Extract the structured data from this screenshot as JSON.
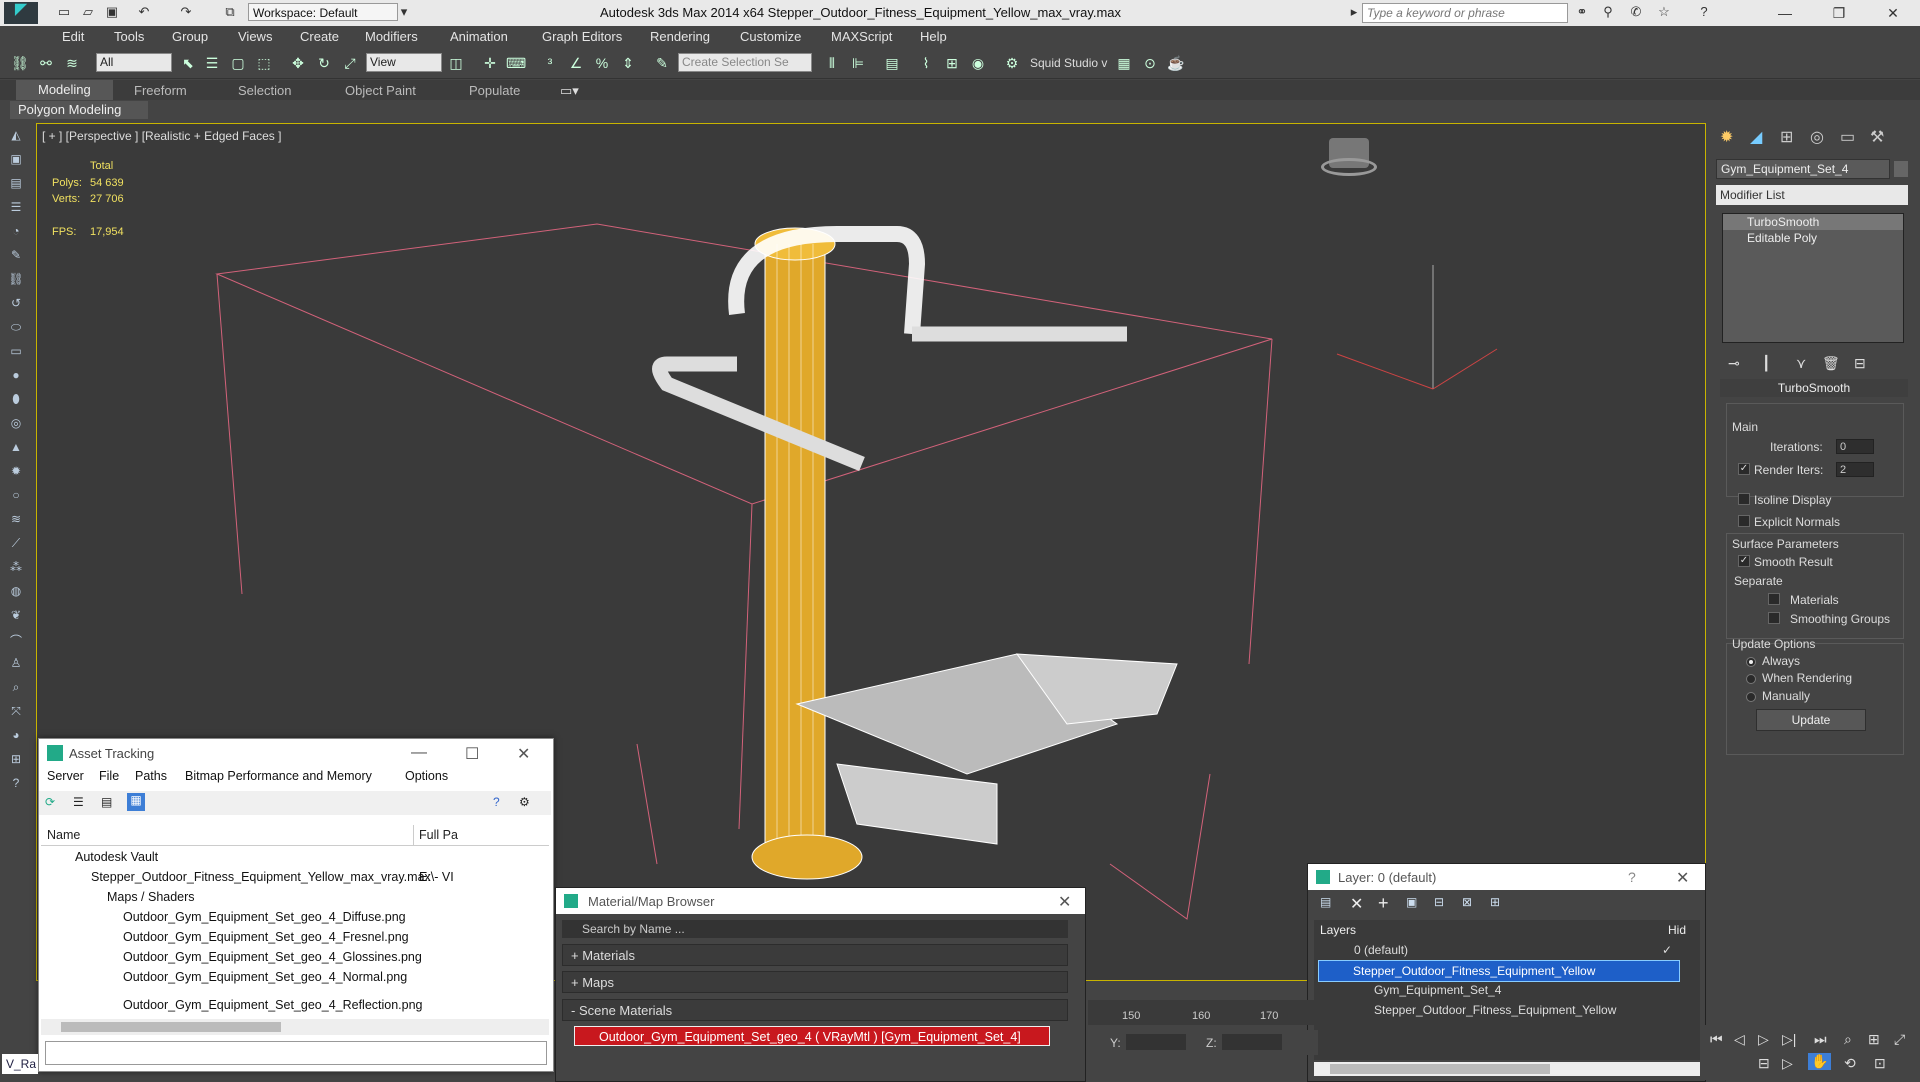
{
  "titlebar": {
    "workspace": "Workspace: Default",
    "title": "Autodesk 3ds Max  2014 x64      Stepper_Outdoor_Fitness_Equipment_Yellow_max_vray.max",
    "search_placeholder": "Type a keyword or phrase"
  },
  "menu": [
    "Edit",
    "Tools",
    "Group",
    "Views",
    "Create",
    "Modifiers",
    "Animation",
    "Graph Editors",
    "Rendering",
    "Customize",
    "MAXScript",
    "Help"
  ],
  "toolbar": {
    "filter": "All",
    "refcoord": "View",
    "selection_set": "Create Selection Se",
    "squid": "Squid Studio v"
  },
  "ribbon": {
    "tabs": [
      "Modeling",
      "Freeform",
      "Selection",
      "Object Paint",
      "Populate"
    ],
    "active": "Modeling",
    "sub": "Polygon Modeling"
  },
  "viewport": {
    "label": "[ + ] [Perspective ] [Realistic + Edged Faces ]",
    "stats_header": "Total",
    "polys_label": "Polys:",
    "polys": "54 639",
    "verts_label": "Verts:",
    "verts": "27 706",
    "fps_label": "FPS:",
    "fps": "17,954",
    "accent": "#c8b400"
  },
  "command_panel": {
    "object_name": "Gym_Equipment_Set_4",
    "modifier_list": "Modifier List",
    "stack": [
      "TurboSmooth",
      "Editable Poly"
    ],
    "rollout": "TurboSmooth",
    "main": "Main",
    "iterations_label": "Iterations:",
    "iterations": "0",
    "render_iters_label": "Render Iters:",
    "render_iters": "2",
    "isoline": "Isoline Display",
    "explicit": "Explicit Normals",
    "surface": "Surface Parameters",
    "smooth_result": "Smooth Result",
    "separate": "Separate",
    "materials": "Materials",
    "smoothing_groups": "Smoothing Groups",
    "update_options": "Update Options",
    "always": "Always",
    "when_rendering": "When Rendering",
    "manually": "Manually",
    "update": "Update"
  },
  "asset_tracking": {
    "title": "Asset Tracking",
    "menu": [
      "Server",
      "File",
      "Paths",
      "Bitmap Performance and Memory",
      "Options"
    ],
    "col_name": "Name",
    "col_path": "Full Pa",
    "rows": [
      {
        "name": "Autodesk Vault",
        "path": ""
      },
      {
        "name": "Stepper_Outdoor_Fitness_Equipment_Yellow_max_vray.max",
        "path": "E:\\- VI"
      },
      {
        "name": "Maps / Shaders",
        "path": ""
      },
      {
        "name": "Outdoor_Gym_Equipment_Set_geo_4_Diffuse.png",
        "path": ""
      },
      {
        "name": "Outdoor_Gym_Equipment_Set_geo_4_Fresnel.png",
        "path": ""
      },
      {
        "name": "Outdoor_Gym_Equipment_Set_geo_4_Glossines.png",
        "path": ""
      },
      {
        "name": "Outdoor_Gym_Equipment_Set_geo_4_Normal.png",
        "path": ""
      },
      {
        "name": "Outdoor_Gym_Equipment_Set_geo_4_Reflection.png",
        "path": ""
      }
    ]
  },
  "material_browser": {
    "title": "Material/Map Browser",
    "search": "Search by Name ...",
    "materials": "+ Materials",
    "maps": "+ Maps",
    "scene": "- Scene Materials",
    "item": "Outdoor_Gym_Equipment_Set_geo_4  ( VRayMtl )  [Gym_Equipment_Set_4]"
  },
  "layers": {
    "title": "Layer: 0 (default)",
    "col": "Layers",
    "col_hide": "Hid",
    "rows": [
      "0 (default)",
      "Stepper_Outdoor_Fitness_Equipment_Yellow",
      "Gym_Equipment_Set_4",
      "Stepper_Outdoor_Fitness_Equipment_Yellow"
    ]
  },
  "timeline": {
    "ticks": [
      "150",
      "160",
      "170"
    ],
    "y_label": "Y:",
    "z_label": "Z:"
  },
  "status": {
    "tag": "V_Ra"
  }
}
